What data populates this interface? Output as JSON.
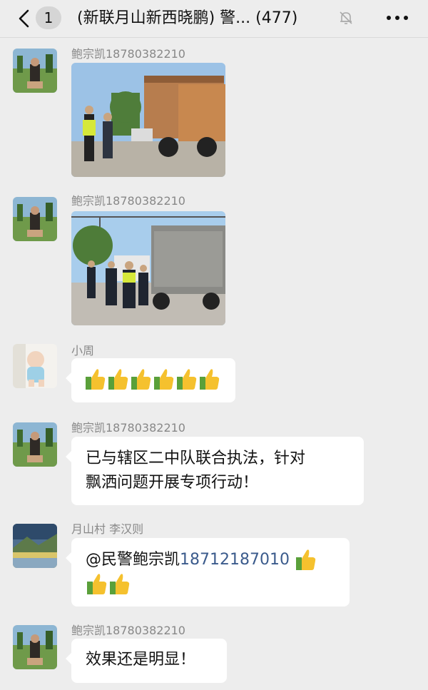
{
  "header": {
    "unread_count": "1",
    "title": "(新联月山新西晓鹏) 警... (477)"
  },
  "messages": [
    {
      "sender": "鲍宗凯18780382210",
      "type": "image",
      "image_desc": "Traffic police officers inspecting a dump truck on a rural road"
    },
    {
      "sender": "鲍宗凯18780382210",
      "type": "image",
      "image_desc": "Police officers walking beside a loaded dump truck"
    },
    {
      "sender": "小周",
      "type": "emoji",
      "emojis": [
        "👍",
        "👍",
        "👍",
        "👍",
        "👍",
        "👍"
      ]
    },
    {
      "sender": "鲍宗凯18780382210",
      "type": "text",
      "line1": "已与辖区二中队联合执法，针对",
      "line2": "飘洒问题开展专项行动！"
    },
    {
      "sender": "月山村  李汉则",
      "type": "mention",
      "mention": "@民警鲍宗凯",
      "phone": "18712187010",
      "emojis": [
        "👍",
        "👍",
        "👍"
      ]
    },
    {
      "sender": "鲍宗凯18780382210",
      "type": "text",
      "line1": "效果还是明显！"
    }
  ],
  "colors": {
    "background": "#ededed",
    "bubble": "#ffffff",
    "link": "#3b5b8c"
  },
  "icons": [
    "back-chevron-icon",
    "mute-bell-icon",
    "more-dots-icon",
    "thumbs-up-icon"
  ]
}
